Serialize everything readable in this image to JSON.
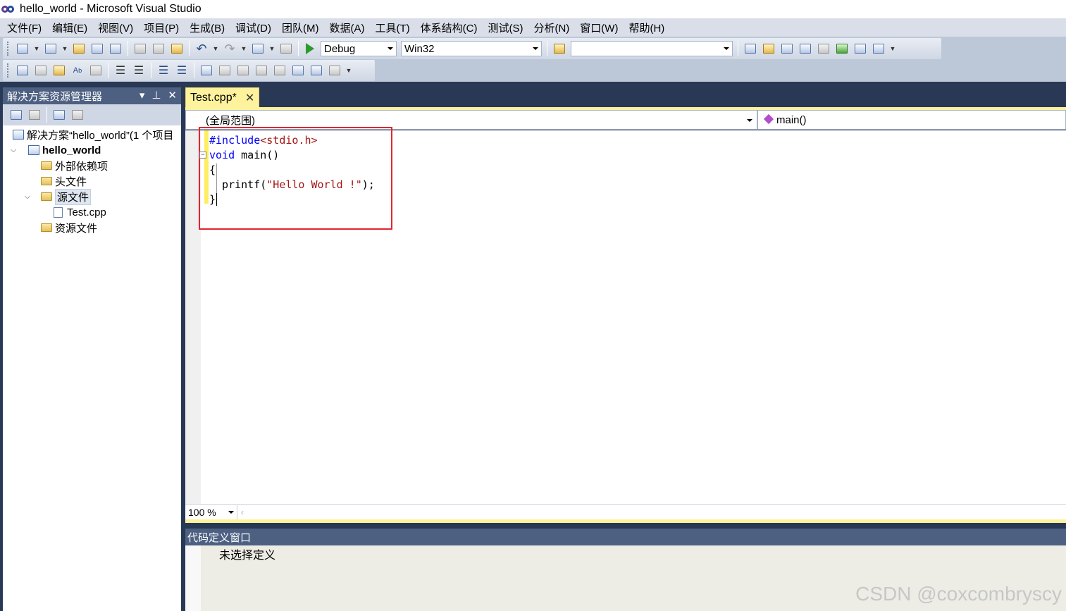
{
  "window": {
    "title": "hello_world - Microsoft Visual Studio"
  },
  "menu": {
    "items": [
      "文件(F)",
      "编辑(E)",
      "视图(V)",
      "项目(P)",
      "生成(B)",
      "调试(D)",
      "团队(M)",
      "数据(A)",
      "工具(T)",
      "体系结构(C)",
      "测试(S)",
      "分析(N)",
      "窗口(W)",
      "帮助(H)"
    ]
  },
  "toolbar": {
    "config": "Debug",
    "platform": "Win32",
    "find_value": ""
  },
  "solution_explorer": {
    "title": "解决方案资源管理器",
    "header_icons": [
      "▾",
      "⊥",
      "✕"
    ],
    "tree": [
      {
        "label": "解决方案“hello_world”(1 个项目",
        "level": 0,
        "icon": "solution-icon"
      },
      {
        "label": "hello_world",
        "level": 0,
        "icon": "project-icon",
        "expander": "⌵"
      },
      {
        "label": "外部依赖项",
        "level": 1,
        "icon": "folder-icon"
      },
      {
        "label": "头文件",
        "level": 1,
        "icon": "folder-icon"
      },
      {
        "label": "源文件",
        "level": 1,
        "icon": "folder-icon",
        "expander": "⌵",
        "selected": true
      },
      {
        "label": "Test.cpp",
        "level": 2,
        "icon": "cpp-file-icon"
      },
      {
        "label": "资源文件",
        "level": 1,
        "icon": "folder-icon"
      }
    ]
  },
  "editor": {
    "tab_label": "Test.cpp*",
    "tab_close": "✕",
    "scope_combo": "(全局范围)",
    "member_combo": "main()",
    "code": {
      "line1_pp": "#include",
      "line1_header": "<stdio.h>",
      "line2_kw": "void",
      "line2_rest": " main()",
      "line3": "{",
      "line4_call": "  printf(",
      "line4_str": "\"Hello World !\"",
      "line4_end": ");",
      "line5": "}"
    },
    "collapse_glyph": "−",
    "zoom": "100 %"
  },
  "code_definition": {
    "title": "代码定义窗口",
    "body": "未选择定义"
  },
  "watermark": "CSDN @coxcombryscy"
}
